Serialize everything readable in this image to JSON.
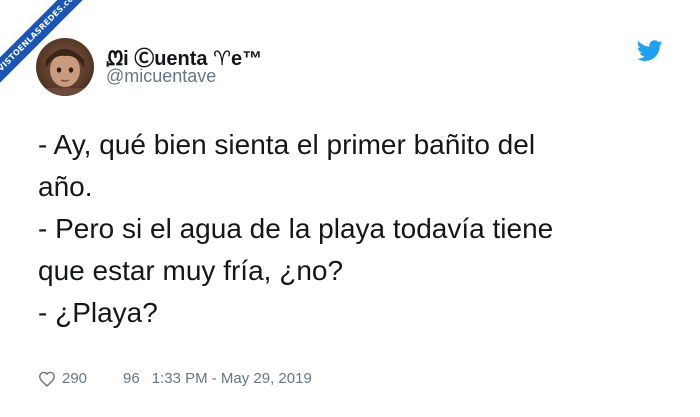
{
  "watermark": "VISTOENLASREDES.com",
  "tweet": {
    "author_name": "ᘻi Ⓒuenta ♈e™",
    "handle": "@micuentave",
    "lines": [
      "- Ay, qué bien sienta el primer bañito del",
      "año.",
      "- Pero si el agua de la playa todavía tiene",
      "que estar muy fría, ¿no?",
      "- ¿Playa?"
    ],
    "likes": "290",
    "second_count": "96",
    "timestamp": "1:33 PM - May 29, 2019"
  },
  "icons": {
    "brand": "twitter-bird-icon",
    "like": "heart-icon"
  },
  "colors": {
    "brand_blue": "#1da1f2",
    "text": "#14171a",
    "muted": "#657786",
    "ribbon": "#1a56b8"
  }
}
